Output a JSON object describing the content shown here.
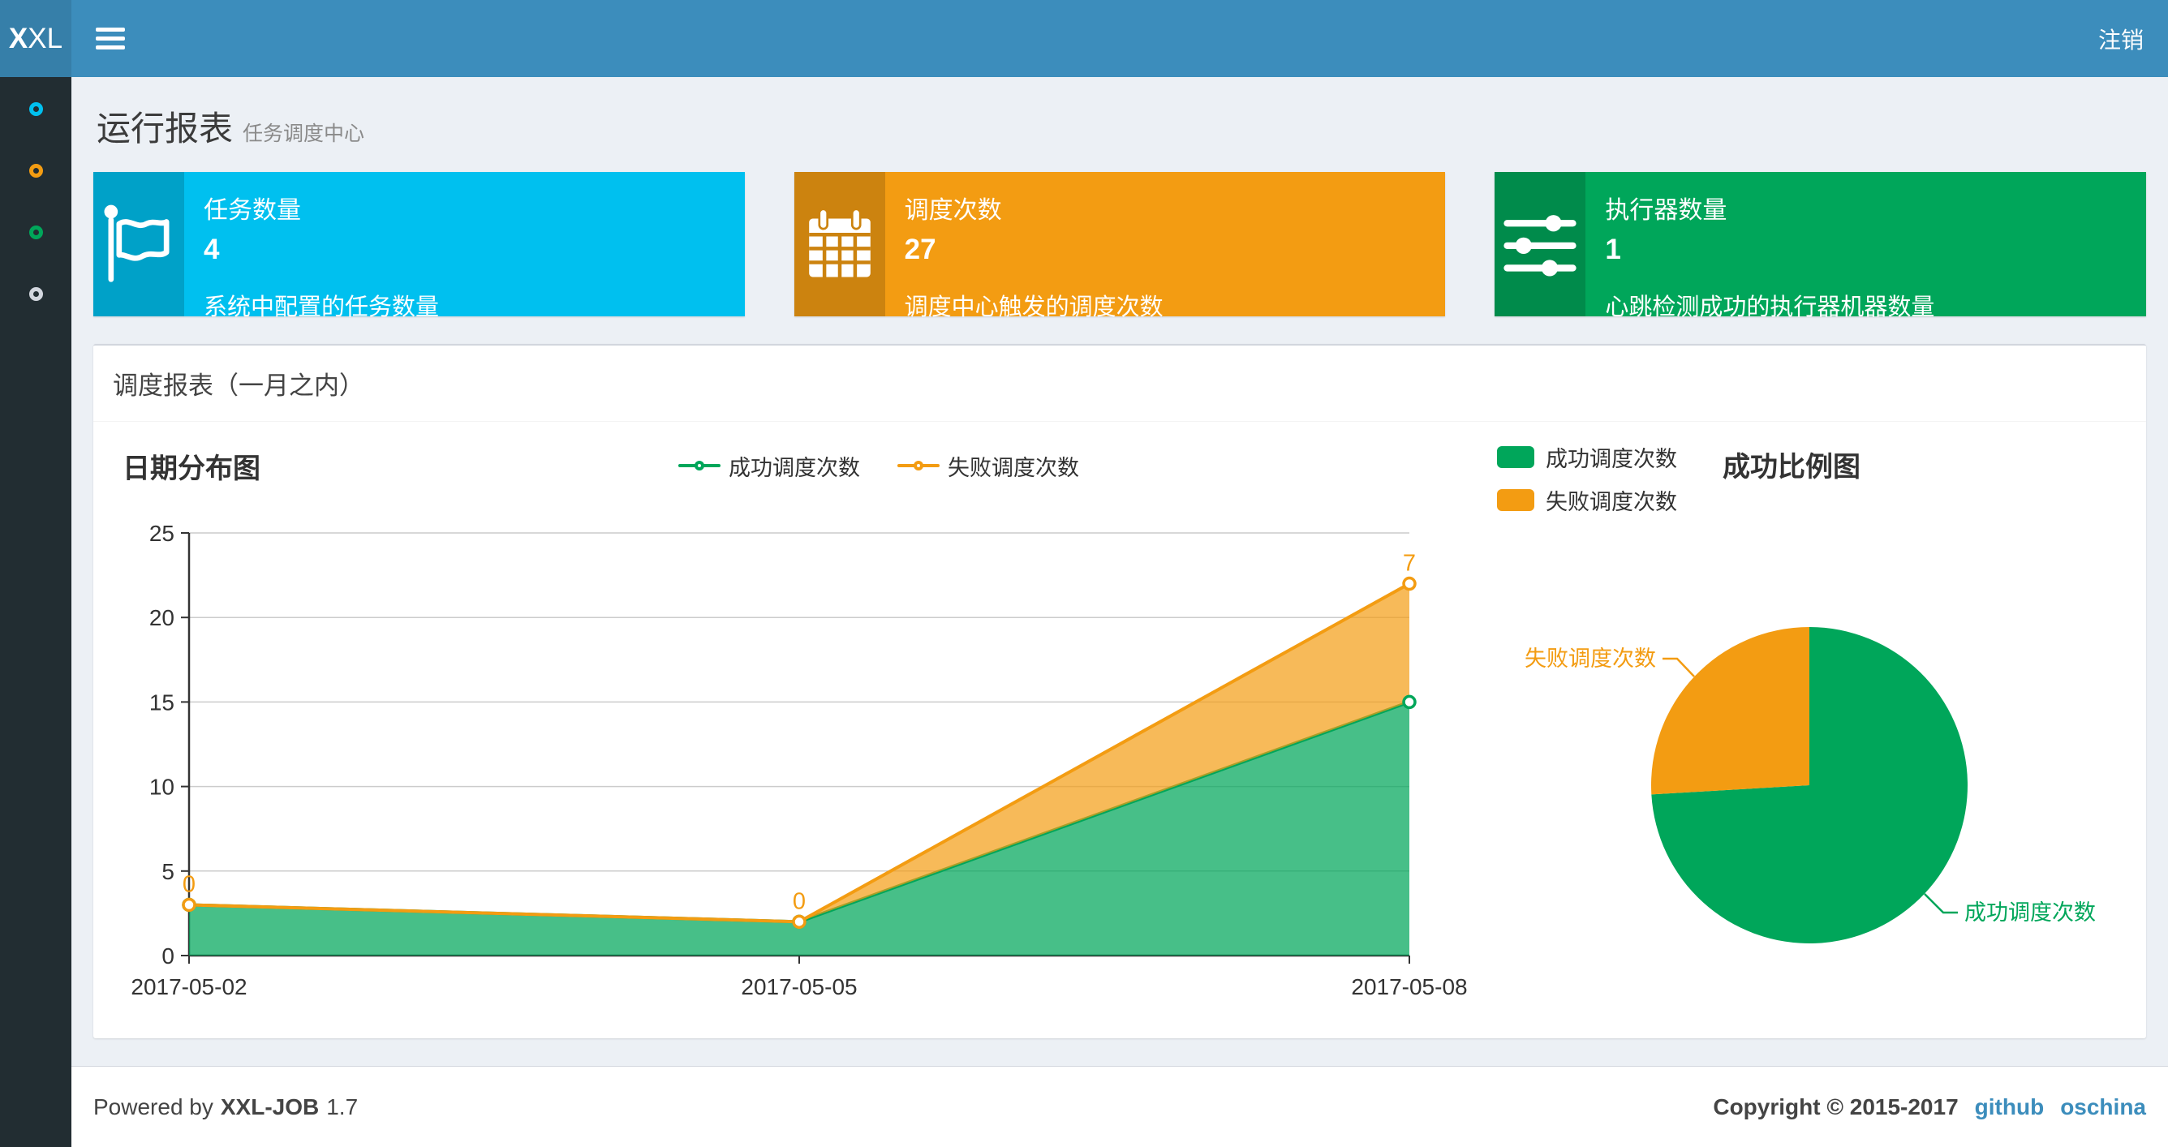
{
  "colors": {
    "navbar": "#3c8dbc",
    "logo_bg": "#367fa9",
    "sidebar_bg": "#222d32",
    "body_bg": "#ecf0f5",
    "success": "#00a65a",
    "warning": "#f39c12",
    "aqua": "#00c0ef",
    "link": "#3c8dbc"
  },
  "navbar": {
    "logo_bold": "X",
    "logo_rest": "XL",
    "logout_label": "注销"
  },
  "sidebar": {
    "items": [
      {
        "icon": "circle-outline-icon",
        "color": "#00c0ef"
      },
      {
        "icon": "circle-outline-icon",
        "color": "#f39c12"
      },
      {
        "icon": "circle-outline-icon",
        "color": "#00a65a"
      },
      {
        "icon": "circle-outline-icon",
        "color": "#d2d6de"
      }
    ]
  },
  "page_header": {
    "title": "运行报表",
    "subtitle": "任务调度中心"
  },
  "info_boxes": [
    {
      "icon": "flag-icon",
      "label": "任务数量",
      "value": "4",
      "description": "系统中配置的任务数量",
      "color": "#00c0ef"
    },
    {
      "icon": "calendar-icon",
      "label": "调度次数",
      "value": "27",
      "description": "调度中心触发的调度次数",
      "color": "#f39c12"
    },
    {
      "icon": "sliders-icon",
      "label": "执行器数量",
      "value": "1",
      "description": "心跳检测成功的执行器机器数量",
      "color": "#00a65a"
    }
  ],
  "panel_title": "调度报表（一月之内）",
  "chart_data": [
    {
      "type": "area",
      "title": "日期分布图",
      "x": [
        "2017-05-02",
        "2017-05-05",
        "2017-05-08"
      ],
      "series": [
        {
          "name": "成功调度次数",
          "values": [
            3,
            2,
            15
          ],
          "color": "#00a65a"
        },
        {
          "name": "失败调度次数",
          "values": [
            0,
            0,
            7
          ],
          "color": "#f39c12",
          "labels": [
            "0",
            "0",
            "7"
          ]
        }
      ],
      "stacked": true,
      "ylim": [
        0,
        25
      ],
      "yticks": [
        0,
        5,
        10,
        15,
        20,
        25
      ],
      "grid": "horizontal",
      "legend_position": "top-center"
    },
    {
      "type": "pie",
      "title": "成功比例图",
      "slices": [
        {
          "name": "成功调度次数",
          "value": 20,
          "color": "#00a65a"
        },
        {
          "name": "失败调度次数",
          "value": 7,
          "color": "#f39c12"
        }
      ],
      "legend_position": "top-left"
    }
  ],
  "footer": {
    "powered_prefix": "Powered by",
    "product": "XXL-JOB",
    "version": "1.7",
    "copyright": "Copyright © 2015-2017",
    "links": [
      "github",
      "oschina"
    ]
  }
}
